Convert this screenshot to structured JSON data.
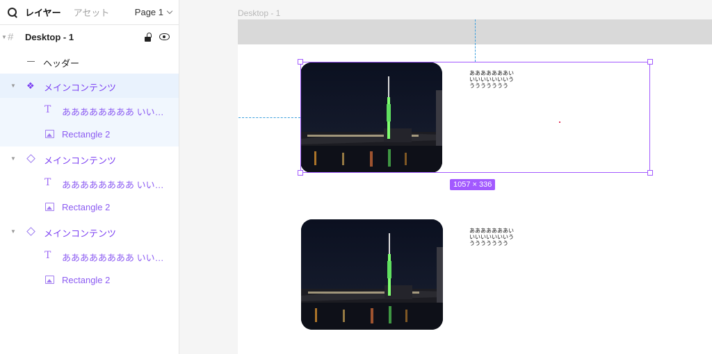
{
  "sidebar": {
    "tabs": [
      {
        "label": "レイヤー",
        "active": true
      },
      {
        "label": "アセット",
        "active": false
      }
    ],
    "page_select": "Page 1",
    "layers": {
      "frame": {
        "label": "Desktop - 1"
      },
      "header": {
        "label": "ヘッダー"
      },
      "groups": [
        {
          "label": "メインコンテンツ",
          "text_child": "ああああああああ いいいい...",
          "image_child": "Rectangle 2",
          "type": "component",
          "selected": true
        },
        {
          "label": "メインコンテンツ",
          "text_child": "ああああああああ いいいい...",
          "image_child": "Rectangle 2",
          "type": "instance",
          "selected": false
        },
        {
          "label": "メインコンテンツ",
          "text_child": "ああああああああ いいいい...",
          "image_child": "Rectangle 2",
          "type": "instance",
          "selected": false
        }
      ]
    }
  },
  "canvas": {
    "frame_title": "Desktop - 1",
    "selection_size": "1057 × 336",
    "cards": [
      {
        "text": "あああああああいいいいいいいいうううううううう"
      },
      {
        "text": "あああああああいいいいいいいいうううううううう"
      }
    ]
  },
  "colors": {
    "selection": "#a259ff",
    "component": "#7b3ff2",
    "guide": "#3a9fdd",
    "header_fill": "#d9d9d9"
  },
  "icons": [
    "search-icon",
    "chevron-down-icon",
    "frame-icon",
    "lock-icon",
    "eye-icon",
    "component-icon",
    "instance-icon",
    "text-icon",
    "image-icon",
    "dash-icon",
    "caret-icon"
  ]
}
